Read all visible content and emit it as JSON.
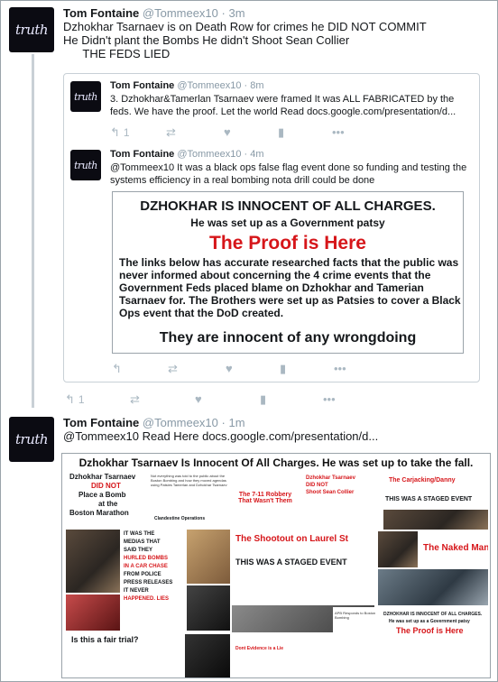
{
  "avatar_text": "truth",
  "tweets": [
    {
      "name": "Tom Fontaine",
      "handle": "@Tommeex10",
      "time": "· 3m",
      "lines": [
        "Dzhokhar Tsarnaev  is on Death Row for crimes he DID NOT COMMIT",
        "He Didn't plant the Bombs He didn't Shoot Sean Collier",
        "      THE FEDS LIED"
      ],
      "actions": {
        "reply_count": "1",
        "retweet_count": "",
        "like_count": ""
      }
    },
    {
      "name": "Tom Fontaine",
      "handle": "@Tommeex10",
      "time": "· 8m",
      "lines": [
        "3. Dzhokhar&Tamerlan Tsarnaev were framed It was ALL FABRICATED by the",
        "feds. We have the proof. Let the world Read docs.google.com/presentation/d..."
      ],
      "actions": {
        "reply_count": "1"
      }
    },
    {
      "name": "Tom Fontaine",
      "handle": "@Tommeex10",
      "time": "· 4m",
      "lines": [
        "@Tommeex10 It was a black ops false flag event done so funding and testing the",
        "systems efficiency in a real bombing nota drill could be done"
      ]
    },
    {
      "name": "Tom Fontaine",
      "handle": "@Tommeex10",
      "time": "· 1m",
      "lines": [
        "@Tommeex10 Read Here docs.google.com/presentation/d..."
      ]
    }
  ],
  "poster": {
    "line1": "DZHOKHAR IS INNOCENT OF ALL CHARGES.",
    "line2": "He was set up as a Government patsy",
    "line3": "The Proof is Here",
    "line4": "The links below has accurate researched facts that the public was never informed about concerning the 4 crime events that the Government Feds placed blame on Dzhokhar and Tamerian Tsarnaev for. The Brothers were set up as Patsies to cover a Black Ops event that the DoD created.",
    "line5": "They are innocent of any wrongdoing"
  },
  "collage": {
    "title": "Dzhokhar Tsarnaev Is Innocent Of All Charges. He was set up to take the fall.",
    "b1_name": "Dzhokhar Tsarnaev",
    "b1_did_not": "DID NOT",
    "b1_place": "Place a Bomb",
    "b1_at": "at the",
    "b1_marathon": "Boston Marathon",
    "b2_text": "Not everything was told to the public about the Boston Bombing and how they moved agendas using Patsies Tamerlan and Dzhokhar Tsarnaev",
    "b2_sub": "Clandestine Operations",
    "b3": "The 7-11 Robbery That Wasn't Them",
    "b4_name": "Dzhokhar Tsarnaev",
    "b4_did_not": "DID NOT",
    "b4_shoot": "Shoot Sean Collier",
    "b5": "The Carjacking/Danny",
    "b6": "THIS WAS A STAGED EVENT",
    "b7_lines": [
      "IT WAS THE",
      "MEDIAS THAT",
      "SAID THEY",
      "HURLED BOMBS",
      "IN A CAR CHASE",
      "FROM POLICE",
      "PRESS RELEASES",
      "IT NEVER",
      "HAPPENED. LIES"
    ],
    "b8": "The Shootout on Laurel St",
    "b9": "The Naked Man",
    "b10": "THIS WAS A STAGED EVENT",
    "b11": "Is this a fair trial?",
    "b12": "Dont Evidence is a Lie",
    "b13_lines": [
      "DZHOKHAR IS INNOCENT OF ALL CHARGES.",
      "He was set up as a Government patsy",
      "The Proof is Here"
    ],
    "b14": "APB Responds to Boston Bombing"
  },
  "colors": {
    "accent": "#d6161a",
    "handle": "#8899a6",
    "icon": "#aab8c2",
    "avatar_bg": "#0b0b12"
  },
  "icons": {
    "reply": "reply-icon",
    "retweet": "retweet-icon",
    "like": "heart-icon",
    "analytics": "analytics-icon",
    "more": "more-icon"
  }
}
